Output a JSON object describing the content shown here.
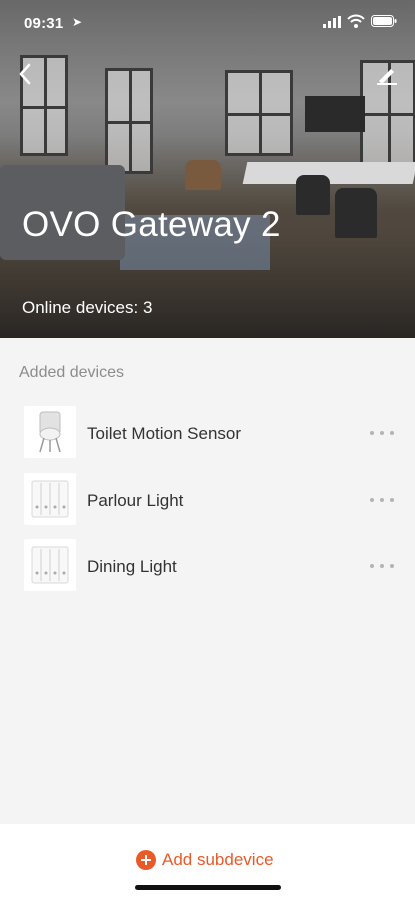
{
  "status_bar": {
    "time": "09:31"
  },
  "header": {
    "title": "OVO Gateway 2",
    "online_devices": "Online devices: 3"
  },
  "section": {
    "label": "Added devices"
  },
  "devices": [
    {
      "name": "Toilet Motion Sensor",
      "icon": "motion-sensor-icon"
    },
    {
      "name": "Parlour Light",
      "icon": "light-switch-icon"
    },
    {
      "name": "Dining Light",
      "icon": "light-switch-icon"
    }
  ],
  "footer": {
    "add_label": "Add subdevice"
  },
  "colors": {
    "accent": "#ea5a29",
    "background": "#f4f4f4",
    "text": "#333333",
    "muted": "#8c8c8c"
  }
}
